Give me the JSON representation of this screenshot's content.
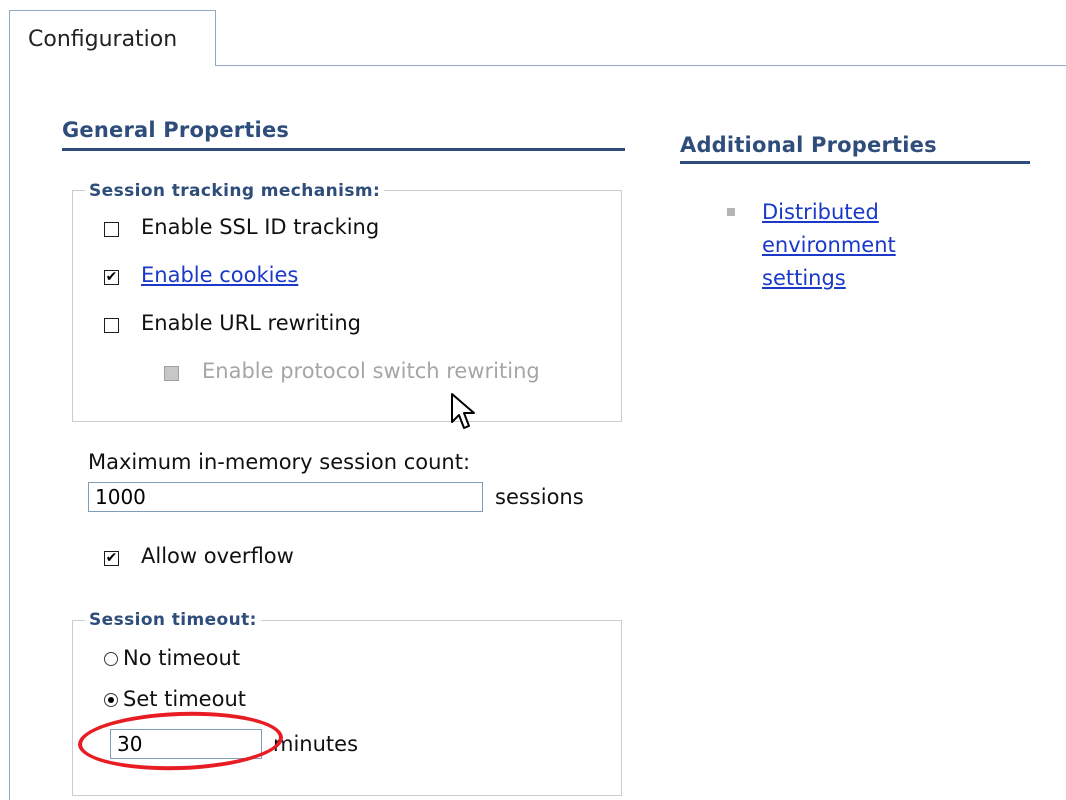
{
  "tabs": [
    {
      "label": "Configuration",
      "active": true
    }
  ],
  "general_properties": {
    "title": "General Properties",
    "session_tracking": {
      "legend": "Session tracking mechanism:",
      "enable_ssl": {
        "label": "Enable SSL ID tracking",
        "checked": false
      },
      "enable_cookies": {
        "label": "Enable cookies",
        "checked": true,
        "is_link": true
      },
      "enable_url_rewriting": {
        "label": "Enable URL rewriting",
        "checked": false
      },
      "enable_protocol_switch": {
        "label": "Enable protocol switch rewriting",
        "checked": true,
        "disabled": true
      }
    },
    "max_sessions": {
      "label": "Maximum in-memory session count:",
      "value": "1000",
      "unit": "sessions"
    },
    "allow_overflow": {
      "label": "Allow overflow",
      "checked": true
    },
    "session_timeout": {
      "legend": "Session timeout:",
      "no_timeout": {
        "label": "No timeout",
        "selected": false
      },
      "set_timeout": {
        "label": "Set timeout",
        "selected": true
      },
      "value": "30",
      "unit": "minutes"
    }
  },
  "additional_properties": {
    "title": "Additional Properties",
    "links": [
      {
        "lines": [
          "Distributed",
          "environment",
          "settings"
        ]
      }
    ]
  },
  "icons": {
    "checkmark": "✔",
    "cursor": "arrow-cursor-icon",
    "bullet": "square-bullet-icon"
  },
  "colors": {
    "heading": "#2e4d7b",
    "link": "#1a39c9",
    "annotation": "#e81c23",
    "tab_border": "#8fa8c8"
  }
}
